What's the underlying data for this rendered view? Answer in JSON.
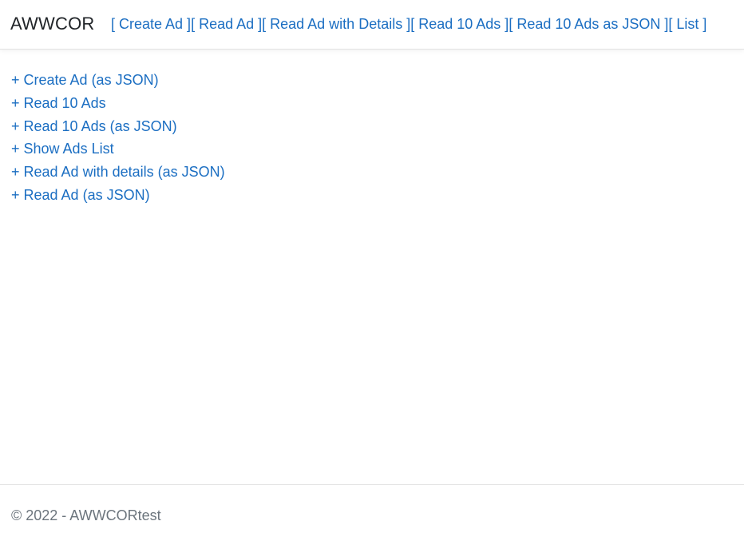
{
  "header": {
    "brand": "AWWCOR",
    "nav_links": [
      "[ Create Ad ]",
      "[ Read Ad ]",
      "[ Read Ad with Details ]",
      "[ Read 10 Ads ]",
      "[ Read 10 Ads as JSON ]",
      "[ List ]"
    ]
  },
  "main": {
    "links": [
      "+ Create Ad (as JSON)",
      "+ Read 10 Ads",
      "+ Read 10 Ads (as JSON)",
      "+ Show Ads List",
      "+ Read Ad with details (as JSON)",
      "+ Read Ad (as JSON)"
    ]
  },
  "footer": {
    "text": "© 2022 - AWWCORtest"
  },
  "colors": {
    "link": "#1b6ec2",
    "text": "#212529",
    "muted": "#6c757d",
    "border": "#e2e2e2"
  }
}
